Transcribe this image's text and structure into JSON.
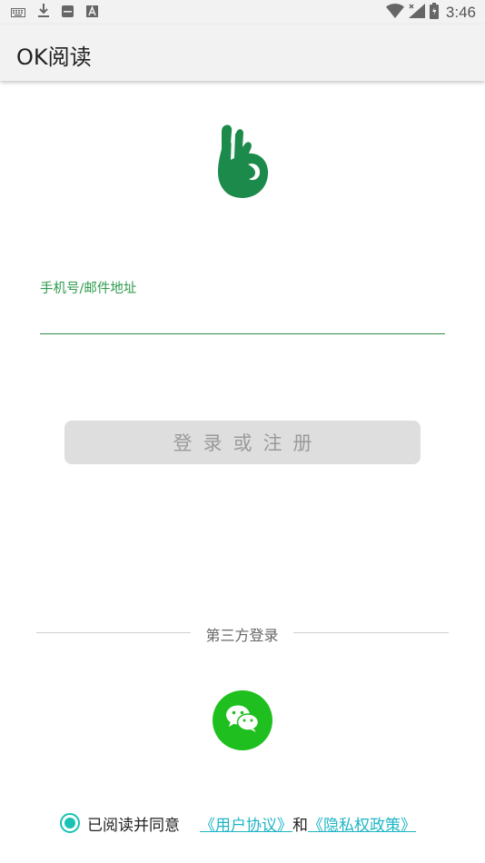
{
  "status_bar": {
    "time": "3:46",
    "left_icons": [
      "keyboard-icon",
      "download-icon",
      "sd-card-icon",
      "font-a-icon"
    ],
    "right_icons": [
      "wifi-icon",
      "signal-icon",
      "battery-icon"
    ]
  },
  "app_bar": {
    "title": "OK阅读"
  },
  "login": {
    "input_label": "手机号/邮件地址",
    "input_value": "",
    "button_label": "登录或注册"
  },
  "third_party": {
    "label": "第三方登录",
    "wechat_icon": "wechat-icon"
  },
  "agreement": {
    "prefix": "已阅读并同意",
    "user_agreement": "《用户协议》",
    "and": "和",
    "privacy_policy": "《隐私权政策》",
    "checked": true
  },
  "colors": {
    "brand_green": "#1b8a4a",
    "label_green": "#2e9a4d",
    "wechat_green": "#1fbf1f",
    "link_teal": "#1fb5c6"
  }
}
